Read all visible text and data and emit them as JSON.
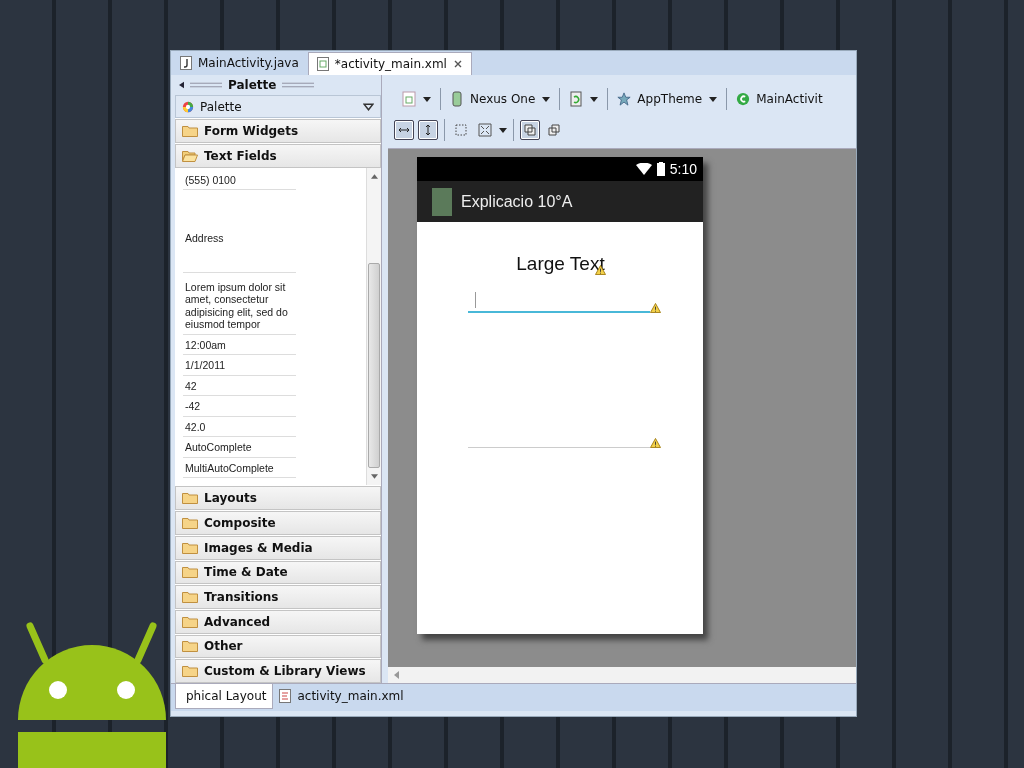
{
  "editor_tabs": [
    {
      "label": "MainActivity.java",
      "kind": "java",
      "selected": false
    },
    {
      "label": "*activity_main.xml",
      "kind": "xml",
      "selected": true
    }
  ],
  "palette": {
    "title": "Palette",
    "dropdown": "Palette",
    "categories": [
      {
        "label": "Form Widgets",
        "expanded": false
      },
      {
        "label": "Text Fields",
        "expanded": true,
        "items": [
          {
            "text": "(555) 0100",
            "kind": "single"
          },
          {
            "text": "Address",
            "kind": "postal"
          },
          {
            "text": "Lorem ipsum dolor sit amet, consectetur adipisicing elit, sed do eiusmod tempor",
            "kind": "multiline"
          },
          {
            "text": "12:00am",
            "kind": "single"
          },
          {
            "text": "1/1/2011",
            "kind": "single"
          },
          {
            "text": "42",
            "kind": "single"
          },
          {
            "text": "-42",
            "kind": "single"
          },
          {
            "text": "42.0",
            "kind": "single"
          },
          {
            "text": "AutoComplete",
            "kind": "single"
          },
          {
            "text": "MultiAutoComplete",
            "kind": "single"
          }
        ]
      },
      {
        "label": "Layouts",
        "expanded": false
      },
      {
        "label": "Composite",
        "expanded": false
      },
      {
        "label": "Images & Media",
        "expanded": false
      },
      {
        "label": "Time & Date",
        "expanded": false
      },
      {
        "label": "Transitions",
        "expanded": false
      },
      {
        "label": "Advanced",
        "expanded": false
      },
      {
        "label": "Other",
        "expanded": false
      },
      {
        "label": "Custom & Library Views",
        "expanded": false
      }
    ]
  },
  "toolbar": {
    "device": "Nexus One",
    "theme": "AppTheme",
    "activity": "MainActivit",
    "toggles": [
      {
        "kind": "fill-width",
        "selected": true
      },
      {
        "kind": "fill-height",
        "selected": true
      },
      {
        "kind": "zoom-select",
        "selected": false
      },
      {
        "kind": "zoom-fit",
        "selected": false
      },
      {
        "kind": "expand",
        "selected": true
      },
      {
        "kind": "collapse",
        "selected": false
      }
    ]
  },
  "preview": {
    "time": "5:10",
    "app_title": "Explicacio 10°A",
    "large_text": "Large Text",
    "fields": [
      {
        "focused": true
      },
      {
        "focused": false
      }
    ]
  },
  "bottom_tabs": [
    {
      "label": "phical Layout",
      "selected": true
    },
    {
      "label": "activity_main.xml",
      "selected": false
    }
  ]
}
